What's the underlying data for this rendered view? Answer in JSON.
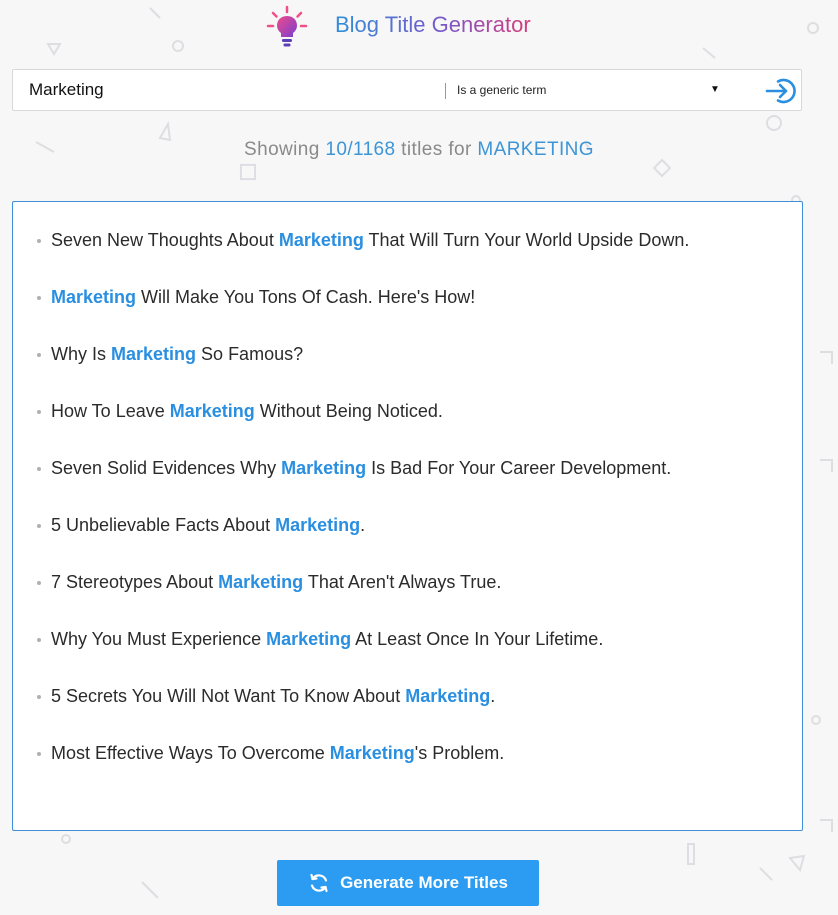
{
  "app": {
    "title": "Blog Title Generator"
  },
  "search": {
    "value": "Marketing",
    "type_selected": "Is a generic term"
  },
  "summary": {
    "prefix": "Showing ",
    "count": "10/1168",
    "middle": " titles for ",
    "keyword": "MARKETING"
  },
  "titles": [
    {
      "before": "Seven New Thoughts About ",
      "keyword": "Marketing",
      "after": " That Will Turn Your World Upside Down."
    },
    {
      "before": "",
      "keyword": "Marketing",
      "after": " Will Make You Tons Of Cash. Here's How!"
    },
    {
      "before": "Why Is ",
      "keyword": "Marketing",
      "after": " So Famous?"
    },
    {
      "before": "How To Leave ",
      "keyword": "Marketing",
      "after": " Without Being Noticed."
    },
    {
      "before": "Seven Solid Evidences Why ",
      "keyword": "Marketing",
      "after": " Is Bad For Your Career Development."
    },
    {
      "before": "5 Unbelievable Facts About ",
      "keyword": "Marketing",
      "after": "."
    },
    {
      "before": "7 Stereotypes About ",
      "keyword": "Marketing",
      "after": " That Aren't Always True."
    },
    {
      "before": "Why You Must Experience ",
      "keyword": "Marketing",
      "after": " At Least Once In Your Lifetime."
    },
    {
      "before": "5 Secrets You Will Not Want To Know About ",
      "keyword": "Marketing",
      "after": "."
    },
    {
      "before": "Most Effective Ways To Overcome ",
      "keyword": "Marketing",
      "after": "'s Problem."
    }
  ],
  "actions": {
    "generate_label": "Generate More Titles"
  },
  "icons": {
    "logo": "lightbulb-icon",
    "go": "arrow-enter-icon",
    "refresh": "refresh-icon",
    "dropdown": "caret-down-icon"
  },
  "colors": {
    "accent": "#2a8fe0",
    "button": "#2b9cf2",
    "border": "#3d8fd8"
  }
}
